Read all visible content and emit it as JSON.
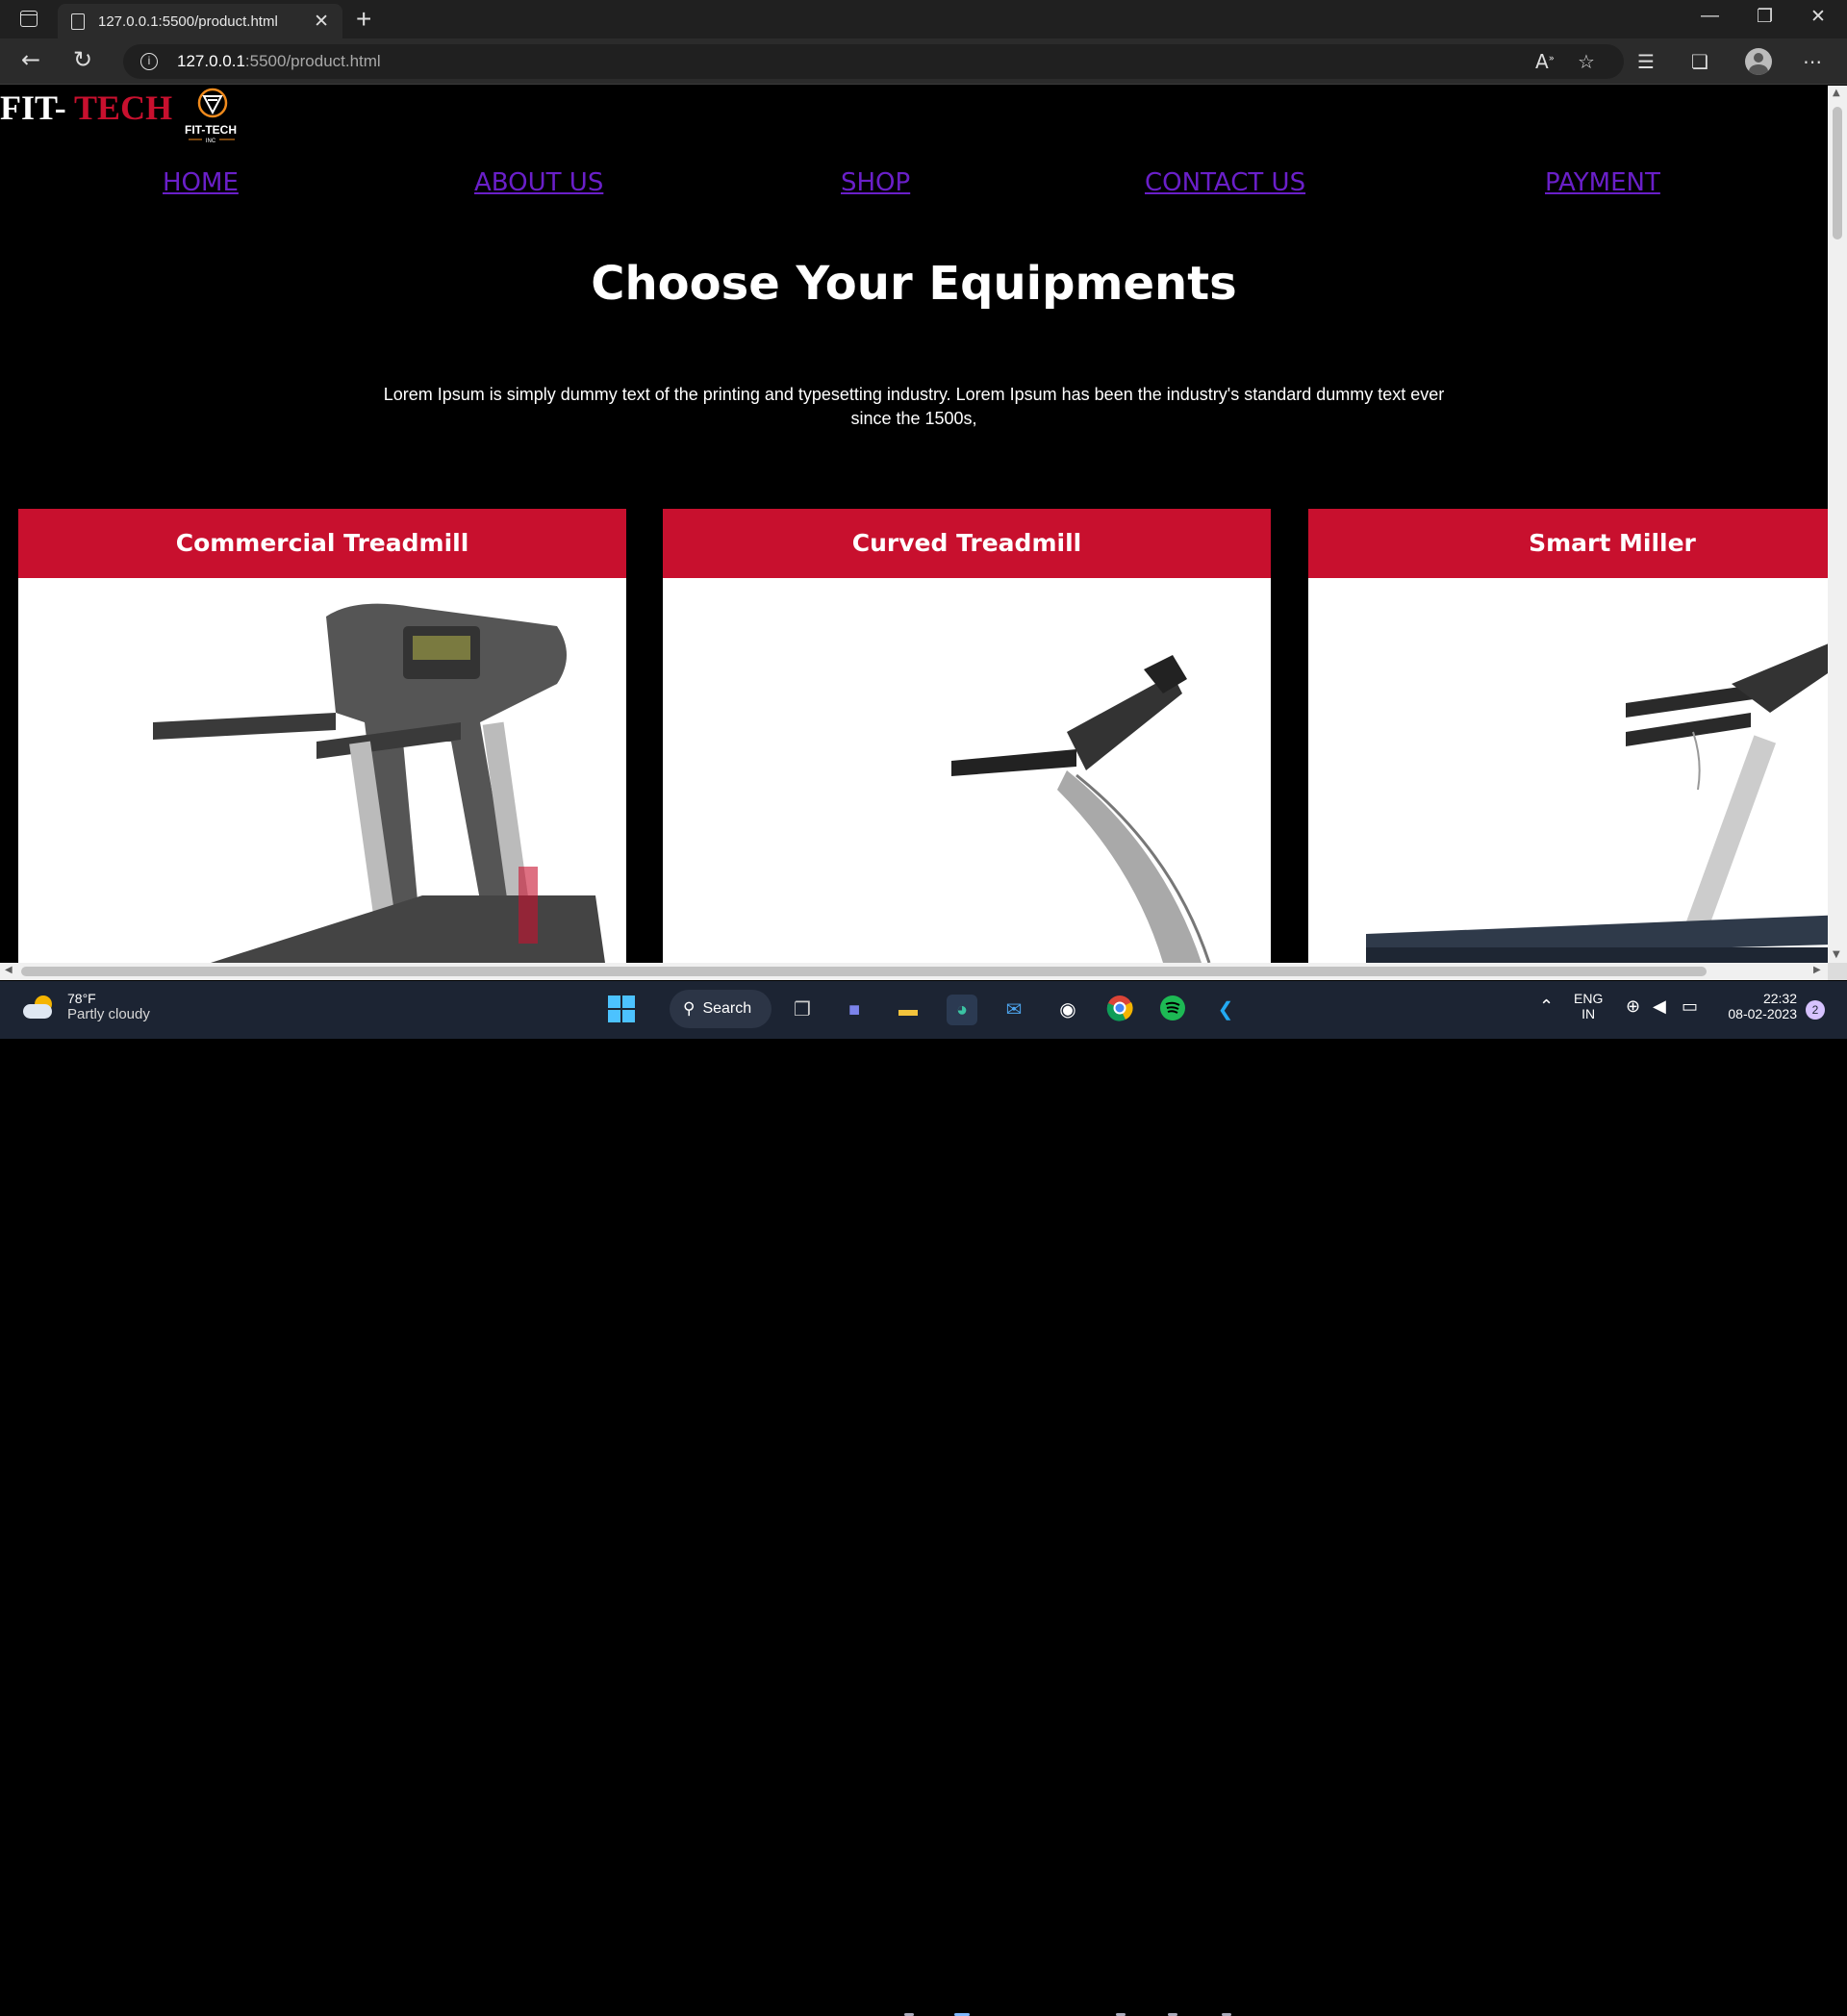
{
  "browser": {
    "tab_title": "127.0.0.1:5500/product.html",
    "url_host": "127.0.0.1",
    "url_path": ":5500/product.html"
  },
  "site": {
    "brand_fit": "FIT- ",
    "brand_tech": "TECH",
    "logo_text": "FIT-TECH",
    "logo_sub": "INC",
    "nav": [
      "HOME",
      "ABOUT US",
      "SHOP",
      "CONTACT US",
      "PAYMENT"
    ],
    "heading": "Choose Your Equipments",
    "lead": "Lorem Ipsum is simply dummy text of the printing and typesetting industry. Lorem Ipsum has been the industry's standard dummy text ever since the 1500s,",
    "cards": [
      "Commercial Treadmill",
      "Curved Treadmill",
      "Smart Miller"
    ]
  },
  "colors": {
    "accent_red": "#c8102e",
    "nav_link": "#6a1fc9",
    "page_bg": "#000000"
  },
  "taskbar": {
    "temp": "78°F",
    "weather": "Partly cloudy",
    "search_label": "Search",
    "lang1": "ENG",
    "lang2": "IN",
    "time": "22:32",
    "date": "08-02-2023",
    "notif_count": "2"
  }
}
